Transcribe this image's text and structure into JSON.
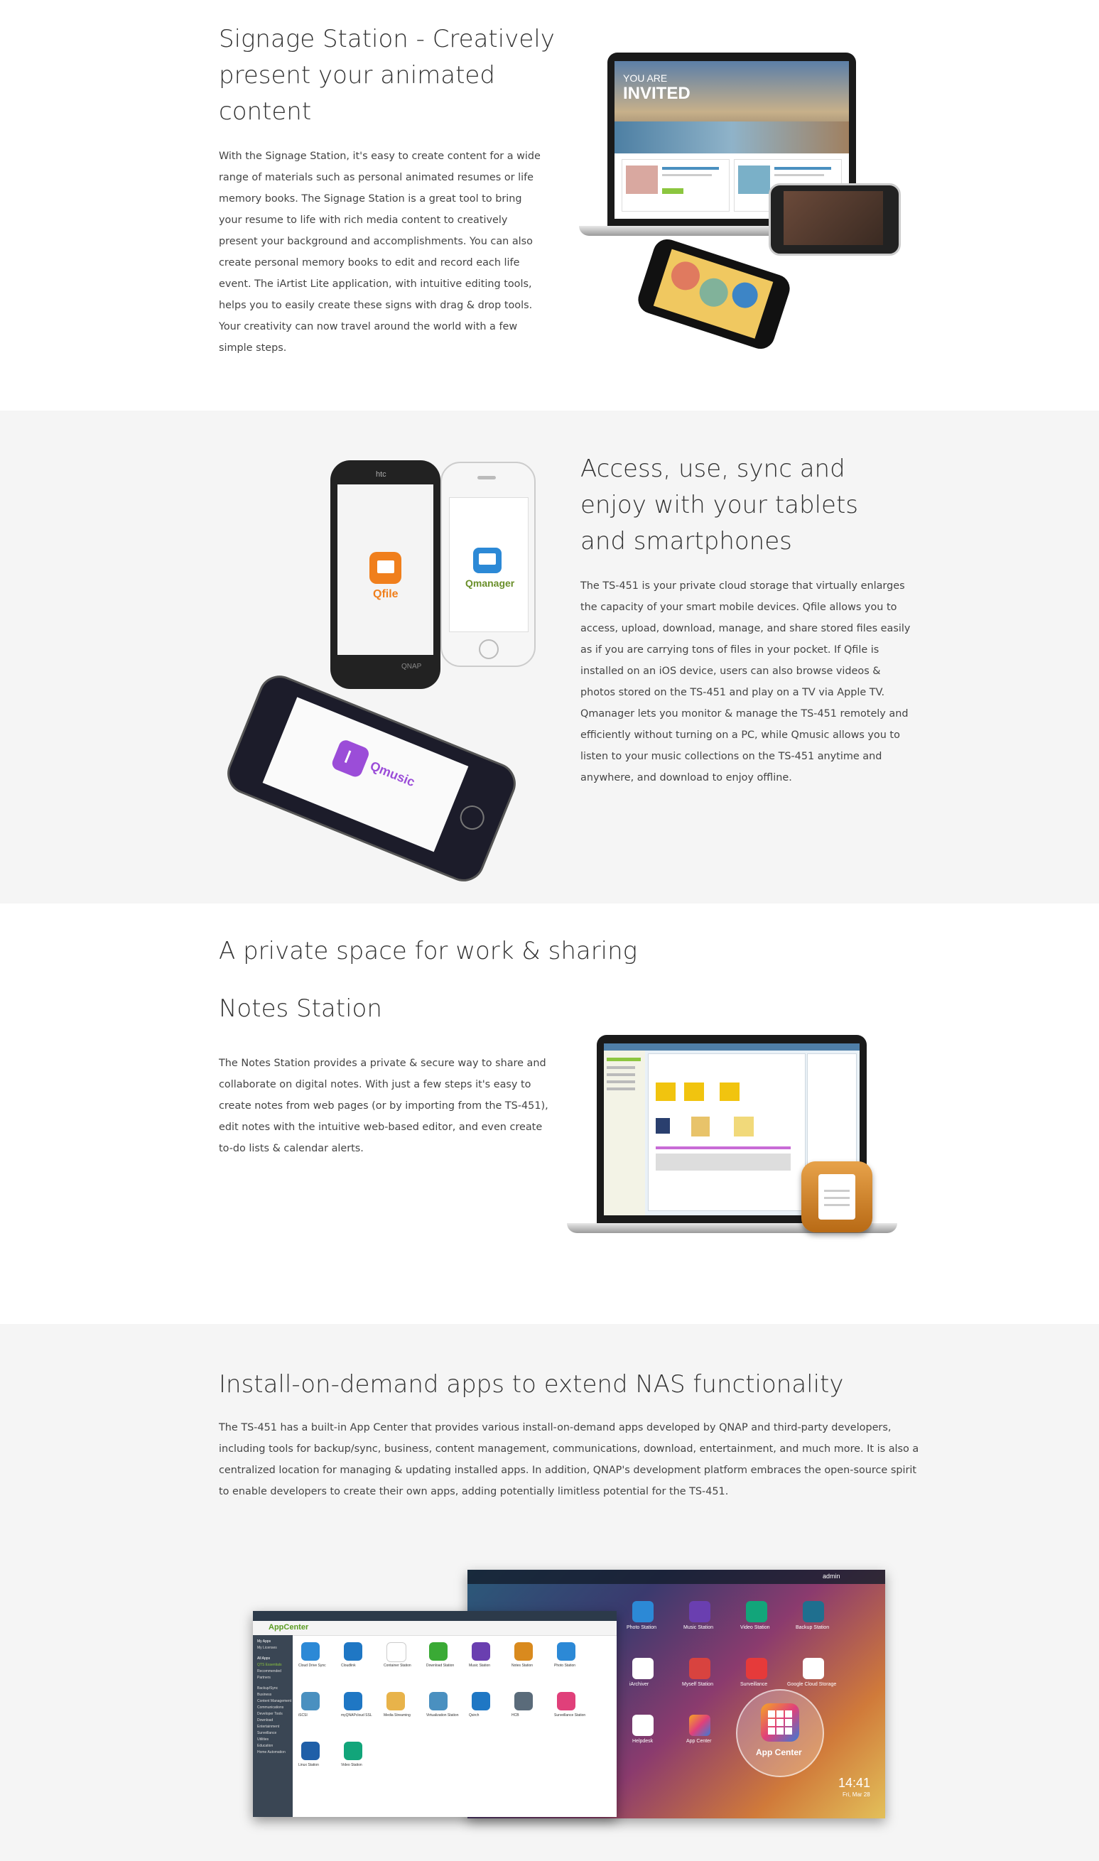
{
  "signage": {
    "title": "Signage Station - Creatively present your animated content",
    "body": "With the Signage Station, it's easy to create content for a wide range of materials such as personal animated resumes or life memory books. The Signage Station is a great tool to bring your resume to life with rich media content to creatively present your background and accomplishments. You can also create personal memory books to edit and record each life event. The iArtist Lite application, with intuitive editing tools, helps you to easily create these signs with drag & drop tools. Your creativity can now travel around the world with a few simple steps.",
    "screen_heading1": "YOU ARE",
    "screen_heading2": "INVITED"
  },
  "mobile": {
    "title": "Access, use, sync and enjoy with your tablets and smartphones",
    "body": "The TS-451 is your private cloud storage that virtually enlarges the capacity of your smart mobile devices. Qfile allows you to access, upload, download, manage, and share stored files easily as if you are carrying tons of files in your pocket. If Qfile is installed on an iOS device, users can also browse videos & photos stored on the TS-451 and play on a TV via Apple TV. Qmanager lets you monitor & manage the TS-451 remotely and efficiently without turning on a PC, while Qmusic allows you to listen to your music collections on the TS-451 anytime and anywhere, and download to enjoy offline.",
    "apps": [
      "Qfile",
      "Qmanager",
      "Qmusic"
    ],
    "brand_htc": "htc",
    "brand_qnap": "QNAP"
  },
  "notes": {
    "title": "A private space for work & sharing",
    "subtitle": "Notes Station",
    "body": "The Notes Station provides a private & secure way to share and collaborate on digital notes. With just a few steps it's easy to create notes from web pages (or by importing from the TS-451), edit notes with the intuitive web-based editor, and even create to-do lists & calendar alerts."
  },
  "appcenter": {
    "title": "Install-on-demand apps to extend NAS functionality",
    "body": "The TS-451 has a built-in App Center that provides various install-on-demand apps developed by QNAP and third-party developers, including tools for backup/sync, business, content management, communications, download, entertainment, and much more. It is also a centralized location for managing & updating installed apps. In addition, QNAP's development platform embraces the open-source spirit to enable developers to create their own apps, adding potentially limitless potential for the TS-451.",
    "window_title": "AppCenter",
    "badge_label": "App Center",
    "clock_time": "14:41",
    "clock_date": "Fri, Mar 28",
    "desktop_user": "admin",
    "desktop_icons": [
      "Photo Station",
      "Music Station",
      "Video Station",
      "Backup Station",
      "iArchiver",
      "Myself Station",
      "Surveillance",
      "Google Cloud Storage",
      "Helpdesk",
      "App Center"
    ],
    "apps": [
      "Cloud Drive Sync",
      "Cloudlink",
      "Container Station",
      "Download Station",
      "Music Station",
      "Notes Station",
      "Photo Station",
      "iSCSI",
      "myQNAPcloud SSL",
      "Media Streaming",
      "Virtualization Station",
      "Qsirch",
      "HCB",
      "Surveillance Station",
      "Linux Station",
      "Video Station"
    ],
    "sidebar_items": [
      "My Apps",
      "My Licenses",
      "All Apps",
      "QTS Essentials",
      "Recommended",
      "Partners",
      "Backup/Sync",
      "Business",
      "Content Management",
      "Communications",
      "Developer Tools",
      "Download",
      "Entertainment",
      "Surveillance",
      "Utilities",
      "Education",
      "Home Automation"
    ],
    "colors": {
      "accent": "#7dbb2e",
      "desktop_bg": "#2f4f6f"
    }
  }
}
